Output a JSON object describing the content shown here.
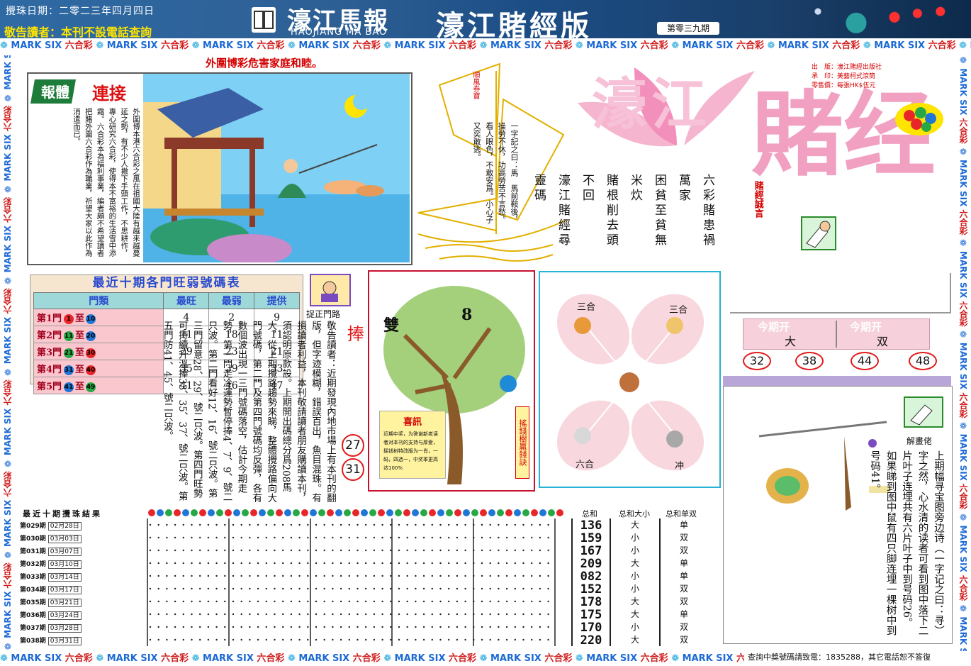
{
  "header": {
    "date_label": "攪珠日期：二零二三年四月四日",
    "warning": "敬告讀者：本刊不設電話查詢",
    "paper_name_cn": "濠江馬報",
    "paper_name_en": "HAOJIANG MA BAO",
    "edition_title": "濠江賭經版",
    "issue_no": "第零三九期"
  },
  "border": {
    "unit_text": "六合彩",
    "unit_text_en": "MARK SIX",
    "bottom_notice": "查詢中獎號碼請致電：1835288，其它電話恕不答復"
  },
  "masthead": {
    "title_1": "濠江",
    "title_2": "賭经",
    "motto_label": "賭經誠言",
    "publisher": "出　版：濠江賭經出版社",
    "printer": "承　印：美藝柯式滾筒",
    "price": "零售價：每張HK$伍元",
    "motto_lines": [
      "六彩賭患禍萬家",
      "困貧至貧無米炊",
      "賭根削去頭不回",
      "濠江賭經尋靈碼"
    ]
  },
  "article": {
    "banner_label": "報體",
    "banner_title": "連接",
    "picture_caption": "外圍博彩危害家庭和睦。",
    "body": "外圍博本港六合彩之風在祖國大陸有越來越蔓延之勢，有不少人撇下手頭工作，不思耕作，專心研究六合彩，使得本不富裕的生活雪中添霜。六合彩本為福利事業，編者頗不希望讀者把賭外圍六合彩作為職業，祈望大家以此作為消遣而已。"
  },
  "sailboat": {
    "flag_text": "順風券寶",
    "poem": "一字記之曰：馬　馬前鞍後，操勞不休，功高勞苦不言愁。看人眼色，不敢安爲。小心子又奕敢逃。"
  },
  "frequency_table": {
    "title": "最近十期各門旺弱號碼表",
    "headers": [
      "門類",
      "最旺",
      "最弱",
      "提供"
    ],
    "rows": [
      {
        "gate": "第1門",
        "from": "1",
        "to": "10",
        "hot": "4",
        "cold": "2",
        "tip": "9",
        "from_color": "#e8262a",
        "to_color": "#1f76d6"
      },
      {
        "gate": "第2門",
        "from": "11",
        "to": "20",
        "hot": "11",
        "cold": "18",
        "tip": "11",
        "from_color": "#27a844",
        "to_color": "#1f76d6"
      },
      {
        "gate": "第3門",
        "from": "21",
        "to": "30",
        "hot": "29",
        "cold": "23",
        "tip": "21",
        "from_color": "#27a844",
        "to_color": "#e8262a"
      },
      {
        "gate": "第4門",
        "from": "31",
        "to": "40",
        "hot": "35",
        "cold": "39",
        "tip": "33",
        "from_color": "#1f76d6",
        "to_color": "#e8262a"
      },
      {
        "gate": "第5門",
        "from": "41",
        "to": "49",
        "hot": "41",
        "cold": "46",
        "tip": "47",
        "from_color": "#1f76d6",
        "to_color": "#27a844"
      }
    ],
    "connector": "至"
  },
  "gate_tip": {
    "icon_label": "捉正門路",
    "title": "旺门号码当捧",
    "numbers": [
      "27",
      "31"
    ],
    "notice": "敬告讀者：近期發現內地市場上有本刊的翻版，但字迹模糊，錯誤百出，魚目混珠。有損讀者利益，本刊敬請讀者朋友購讀本刊，須認明原款設。上期開出碼總分爲208馬大，從上期攪路趨勢來睇，整體攪路偏向大門號碼，第二門及第四門號碼均反彈，各有數個波出現一三門號碼落空，估計今期走勢，第一門走冷運勢暫停捧4、7、9、號二只波。第二門看好12、16、號二只波。第三門留意28、29、號二只波。第四門旺勢可持續升溫捧33、35、37、號二只波。第五門防41、45、號二只波。"
  },
  "tree": {
    "big_char": "雙",
    "number": "8",
    "news_title": "喜訊",
    "news_body": "近期中奖，为答谢新老读者对本刊的支持与厚爱，摇钱树特改版为一肖，一码，四选一，中奖率更高达100%",
    "side_label": "搖錢樹贏錢訣"
  },
  "zodiac": {
    "labels": [
      "三合",
      "三合",
      "六合",
      "冲"
    ]
  },
  "this_issue": {
    "label_left": "今期开",
    "label_right": "今期开",
    "value_left": "大",
    "value_right": "双",
    "numbers": [
      "32",
      "38",
      "44",
      "48"
    ]
  },
  "picture_puzzle": {
    "label": "解畫佬",
    "text": "上期幅寻宝图旁边诗（一字记之曰：寻）字之然，心水清的读者可看到图中落下二片叶子连埋共有六片叶子中到号码26。如果睇到图中鼠有四只脚连埋一棵树中到号码41。"
  },
  "results": {
    "title": "最近十期攪珠結果",
    "col_sum": "总和",
    "col_bigsmall": "总和大小",
    "col_oddeven": "总和单双",
    "rows": [
      {
        "issue": "第029期",
        "date": "02月28日",
        "sum": "136",
        "bs": "大",
        "oe": "单"
      },
      {
        "issue": "第030期",
        "date": "03月03日",
        "sum": "159",
        "bs": "小",
        "oe": "双"
      },
      {
        "issue": "第031期",
        "date": "03月07日",
        "sum": "167",
        "bs": "小",
        "oe": "双"
      },
      {
        "issue": "第032期",
        "date": "03月10日",
        "sum": "209",
        "bs": "大",
        "oe": "单"
      },
      {
        "issue": "第033期",
        "date": "03月14日",
        "sum": "082",
        "bs": "小",
        "oe": "单"
      },
      {
        "issue": "第034期",
        "date": "03月17日",
        "sum": "152",
        "bs": "小",
        "oe": "双"
      },
      {
        "issue": "第035期",
        "date": "03月21日",
        "sum": "178",
        "bs": "大",
        "oe": "双"
      },
      {
        "issue": "第036期",
        "date": "03月24日",
        "sum": "175",
        "bs": "大",
        "oe": "单"
      },
      {
        "issue": "第037期",
        "date": "03月28日",
        "sum": "170",
        "bs": "小",
        "oe": "双"
      },
      {
        "issue": "第038期",
        "date": "03月31日",
        "sum": "220",
        "bs": "大",
        "oe": "双"
      }
    ]
  },
  "colors": {
    "header_blue": "#1d4d86",
    "warning_yellow": "#ffe400",
    "accent_red": "#e21a1a",
    "frame_blue": "#2a6fc9",
    "pink_title": "#f2a3c4"
  }
}
